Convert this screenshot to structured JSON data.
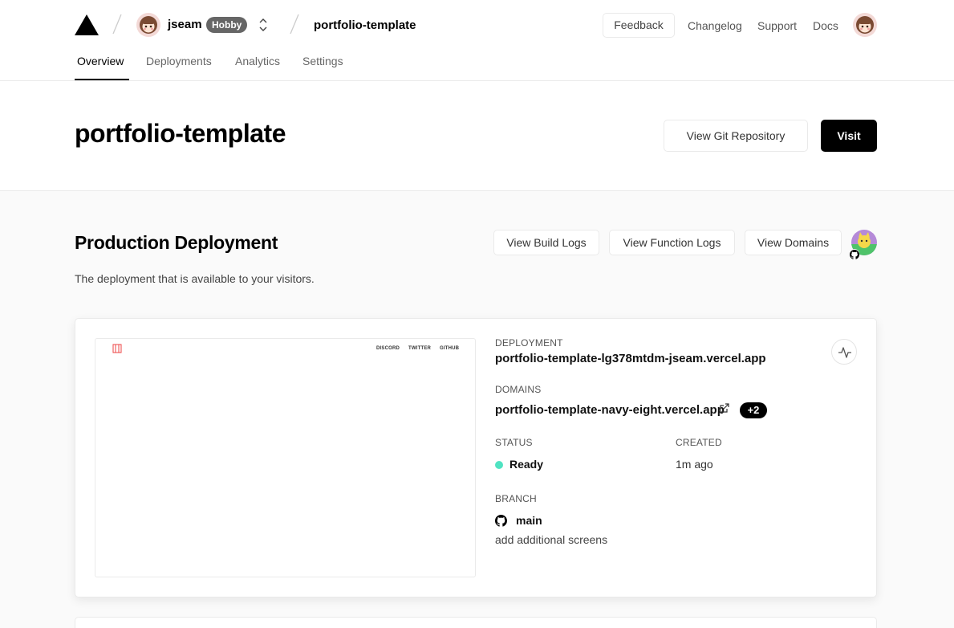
{
  "header": {
    "user": {
      "name": "jseam",
      "plan_badge": "Hobby",
      "avatar": "anime-avatar"
    },
    "project_name": "portfolio-template",
    "links": {
      "feedback": "Feedback",
      "changelog": "Changelog",
      "support": "Support",
      "docs": "Docs"
    },
    "tabs": [
      "Overview",
      "Deployments",
      "Analytics",
      "Settings"
    ],
    "active_tab": "Overview"
  },
  "project": {
    "title": "portfolio-template",
    "view_git_label": "View Git Repository",
    "visit_label": "Visit"
  },
  "production": {
    "title": "Production Deployment",
    "description": "The deployment that is available to your visitors.",
    "buttons": {
      "build_logs": "View Build Logs",
      "function_logs": "View Function Logs",
      "domains": "View Domains"
    }
  },
  "deployment": {
    "preview_links": [
      "DISCORD",
      "TWITTER",
      "GITHUB"
    ],
    "deployment_label": "DEPLOYMENT",
    "deployment_url": "portfolio-template-lg378mtdm-jseam.vercel.app",
    "domains_label": "DOMAINS",
    "domain": "portfolio-template-navy-eight.vercel.app",
    "domains_extra": "+2",
    "status_label": "STATUS",
    "status": "Ready",
    "created_label": "CREATED",
    "created": "1m ago",
    "branch_label": "BRANCH",
    "branch": "main",
    "commit_message": "add additional screens"
  },
  "colors": {
    "accent": "#000000",
    "ready": "#50e3c2",
    "badge": "#666666"
  }
}
